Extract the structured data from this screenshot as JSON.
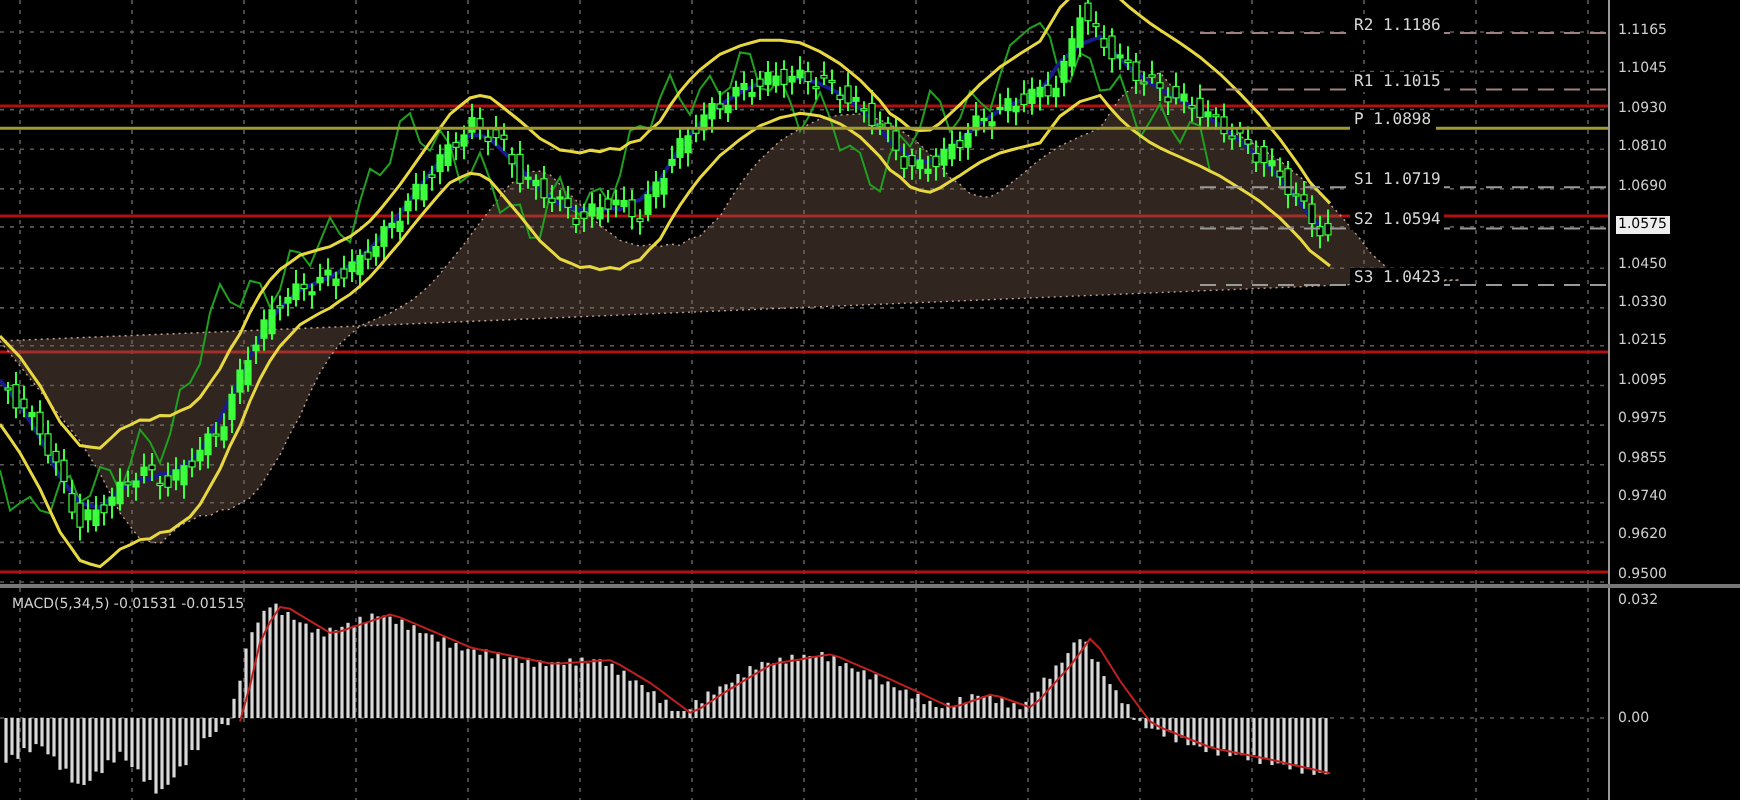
{
  "price_panel": {
    "pivots": [
      {
        "label": "R2",
        "value": "1.1186",
        "kind": "resistance"
      },
      {
        "label": "R1",
        "value": "1.1015",
        "kind": "resistance"
      },
      {
        "label": "P",
        "value": "1.0898",
        "kind": "pivot"
      },
      {
        "label": "S1",
        "value": "1.0719",
        "kind": "support"
      },
      {
        "label": "S2",
        "value": "1.0594",
        "kind": "support"
      },
      {
        "label": "S3",
        "value": "1.0423",
        "kind": "support"
      }
    ],
    "axis_labels": [
      {
        "text": "1.1165",
        "selected": false
      },
      {
        "text": "1.1045",
        "selected": false
      },
      {
        "text": "1.0930",
        "selected": false
      },
      {
        "text": "1.0810",
        "selected": false
      },
      {
        "text": "1.0690",
        "selected": false
      },
      {
        "text": "1.0575",
        "selected": true
      },
      {
        "text": "1.0450",
        "selected": false
      },
      {
        "text": "1.0330",
        "selected": false
      },
      {
        "text": "1.0215",
        "selected": false
      },
      {
        "text": "1.0095",
        "selected": false
      },
      {
        "text": "0.9975",
        "selected": false
      },
      {
        "text": "0.9855",
        "selected": false
      },
      {
        "text": "0.9740",
        "selected": false
      },
      {
        "text": "0.9620",
        "selected": false
      },
      {
        "text": "0.9500",
        "selected": false
      }
    ]
  },
  "macd_panel": {
    "title": "MACD(5,34,5) -0.01531 -0.01515",
    "axis_labels": [
      "0.032",
      "0.00"
    ]
  }
}
